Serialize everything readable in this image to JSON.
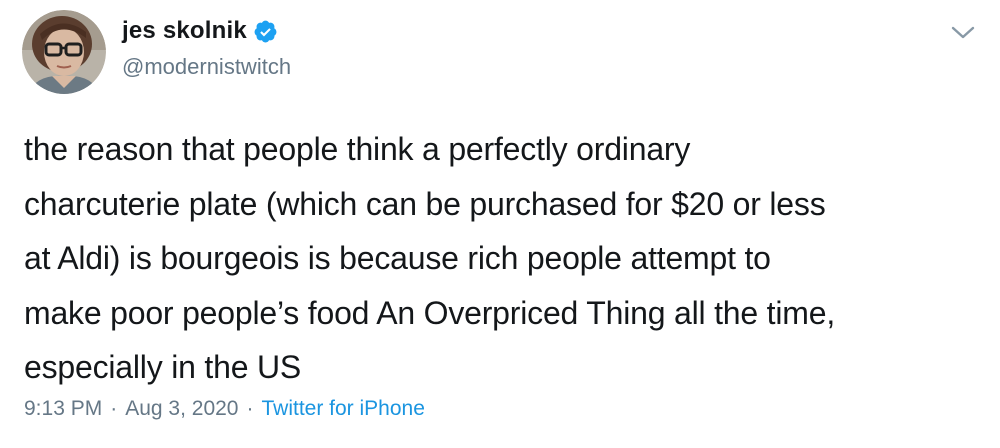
{
  "author": {
    "display_name": "jes skolnik",
    "handle": "@modernistwitch",
    "verified": true,
    "avatar": "profile-photo-woman-with-glasses"
  },
  "menu": {
    "icon": "chevron-down-icon"
  },
  "tweet": {
    "text": "the reason that people think a perfectly ordinary\ncharcuterie plate (which can be purchased for $20 or less\nat Aldi) is bourgeois is because rich people attempt to\nmake poor people’s food An Overpriced Thing all the time,\nespecially in the US"
  },
  "meta": {
    "time": "9:13 PM",
    "separator": "·",
    "date": "Aug 3, 2020",
    "source": "Twitter for iPhone"
  },
  "colors": {
    "text": "#14171a",
    "secondary": "#657786",
    "link": "#1b95e0",
    "verified": "#1da1f2"
  }
}
